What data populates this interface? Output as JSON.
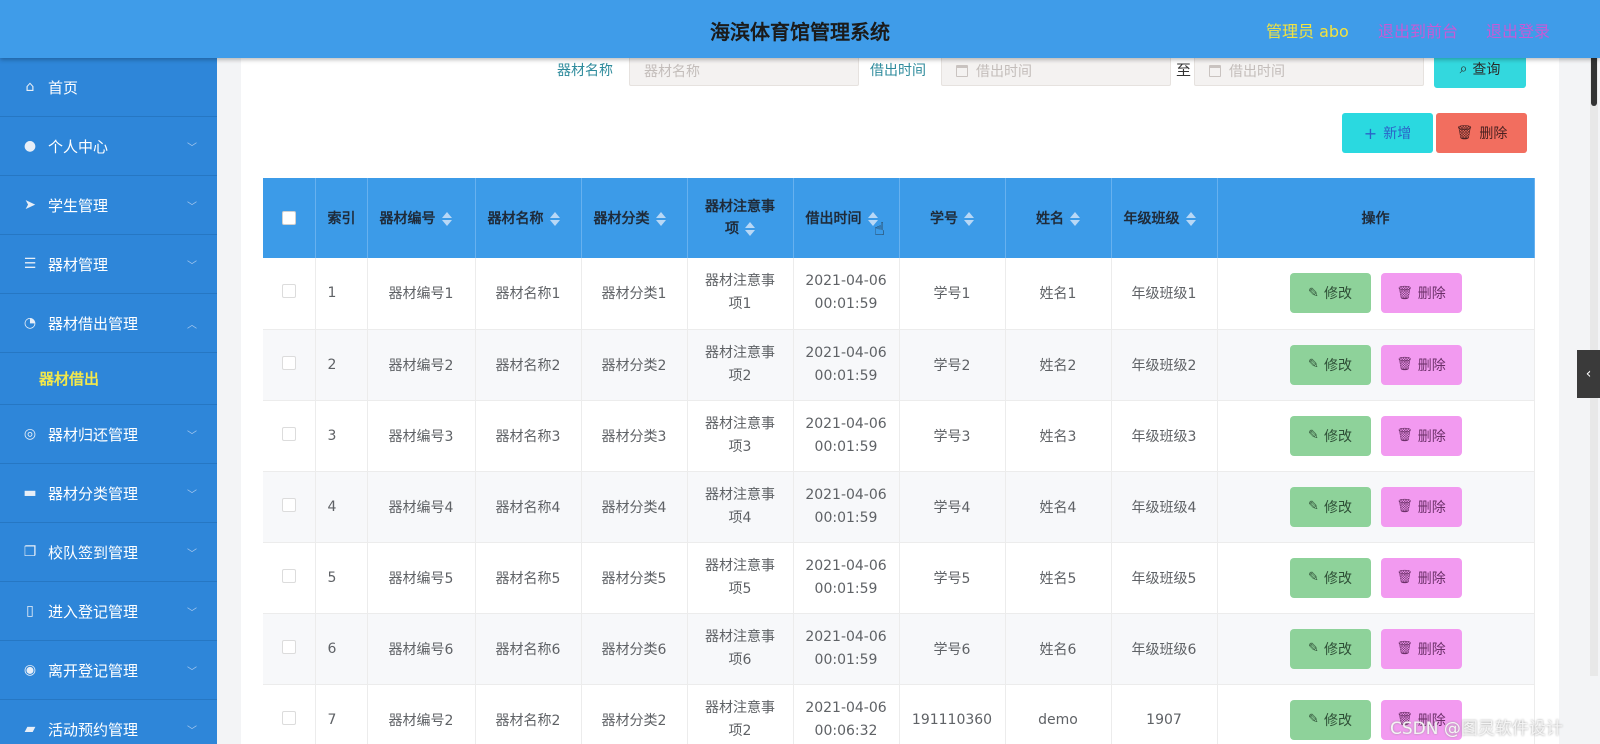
{
  "header": {
    "title": "海滨体育馆管理系统",
    "admin": "管理员 abo",
    "to_front": "退出到前台",
    "logout": "退出登录"
  },
  "sidebar": {
    "items": [
      {
        "label": "首页",
        "icon": "home-icon"
      },
      {
        "label": "个人中心",
        "icon": "user-icon"
      },
      {
        "label": "学生管理",
        "icon": "send-icon"
      },
      {
        "label": "器材管理",
        "icon": "list-icon"
      },
      {
        "label": "器材借出管理",
        "icon": "clock-icon"
      },
      {
        "label": "器材归还管理",
        "icon": "target-icon"
      },
      {
        "label": "器材分类管理",
        "icon": "tag-icon"
      },
      {
        "label": "校队签到管理",
        "icon": "copy-icon"
      },
      {
        "label": "进入登记管理",
        "icon": "phone-icon"
      },
      {
        "label": "离开登记管理",
        "icon": "location-icon"
      },
      {
        "label": "活动预约管理",
        "icon": "briefcase-icon"
      }
    ],
    "active_sub": "器材借出"
  },
  "search": {
    "name_label": "器材名称",
    "name_placeholder": "器材名称",
    "time_label": "借出时间",
    "start_placeholder": "借出时间",
    "to": "至",
    "end_placeholder": "借出时间",
    "query_label": "查询"
  },
  "actions": {
    "add_label": "新增",
    "delete_label": "删除"
  },
  "table": {
    "headers": {
      "index": "索引",
      "code": "器材编号",
      "name": "器材名称",
      "category": "器材分类",
      "notes": "器材注意事项",
      "time": "借出时间",
      "student_id": "学号",
      "student_name": "姓名",
      "class": "年级班级",
      "ops": "操作"
    },
    "edit_label": "修改",
    "delete_label": "删除",
    "rows": [
      {
        "index": "1",
        "code": "器材编号1",
        "name": "器材名称1",
        "category": "器材分类1",
        "notes": "器材注意事项1",
        "date": "2021-04-06",
        "clock": "00:01:59",
        "student_id": "学号1",
        "student_name": "姓名1",
        "class": "年级班级1"
      },
      {
        "index": "2",
        "code": "器材编号2",
        "name": "器材名称2",
        "category": "器材分类2",
        "notes": "器材注意事项2",
        "date": "2021-04-06",
        "clock": "00:01:59",
        "student_id": "学号2",
        "student_name": "姓名2",
        "class": "年级班级2"
      },
      {
        "index": "3",
        "code": "器材编号3",
        "name": "器材名称3",
        "category": "器材分类3",
        "notes": "器材注意事项3",
        "date": "2021-04-06",
        "clock": "00:01:59",
        "student_id": "学号3",
        "student_name": "姓名3",
        "class": "年级班级3"
      },
      {
        "index": "4",
        "code": "器材编号4",
        "name": "器材名称4",
        "category": "器材分类4",
        "notes": "器材注意事项4",
        "date": "2021-04-06",
        "clock": "00:01:59",
        "student_id": "学号4",
        "student_name": "姓名4",
        "class": "年级班级4"
      },
      {
        "index": "5",
        "code": "器材编号5",
        "name": "器材名称5",
        "category": "器材分类5",
        "notes": "器材注意事项5",
        "date": "2021-04-06",
        "clock": "00:01:59",
        "student_id": "学号5",
        "student_name": "姓名5",
        "class": "年级班级5"
      },
      {
        "index": "6",
        "code": "器材编号6",
        "name": "器材名称6",
        "category": "器材分类6",
        "notes": "器材注意事项6",
        "date": "2021-04-06",
        "clock": "00:01:59",
        "student_id": "学号6",
        "student_name": "姓名6",
        "class": "年级班级6"
      },
      {
        "index": "7",
        "code": "器材编号2",
        "name": "器材名称2",
        "category": "器材分类2",
        "notes": "器材注意事项2",
        "date": "2021-04-06",
        "clock": "00:06:32",
        "student_id": "191110360",
        "student_name": "demo",
        "class": "1907"
      }
    ]
  },
  "watermark": "CSDN @图灵软件设计"
}
